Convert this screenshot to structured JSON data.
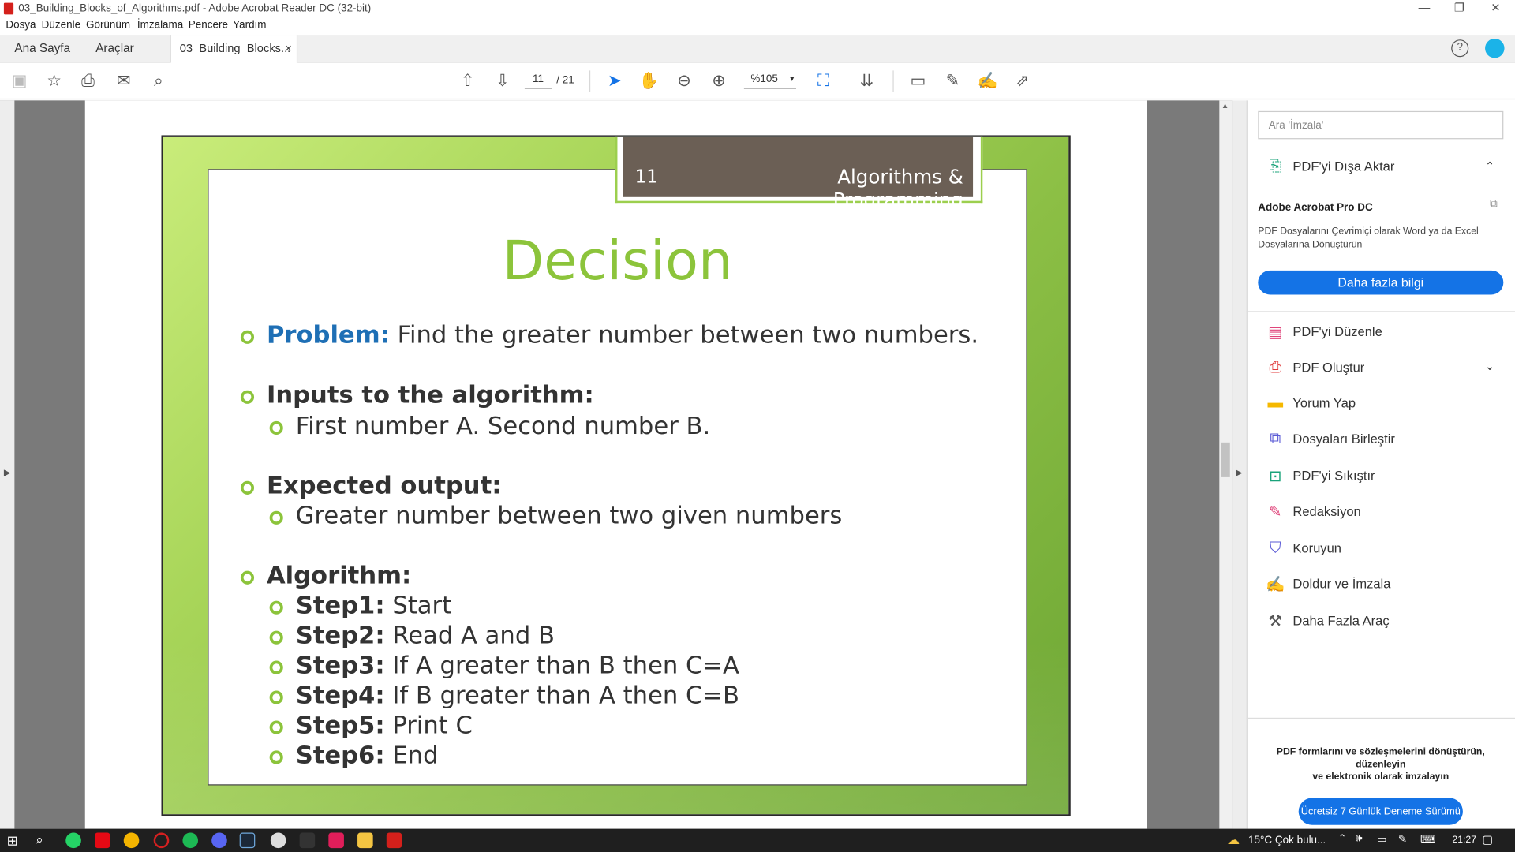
{
  "window": {
    "title": "03_Building_Blocks_of_Algorithms.pdf - Adobe Acrobat Reader DC (32-bit)"
  },
  "menu": [
    "Dosya",
    "Düzenle",
    "Görünüm",
    "İmzalama",
    "Pencere",
    "Yardım"
  ],
  "tabs": {
    "home": "Ana Sayfa",
    "tools": "Araçlar",
    "doc": "03_Building_Blocks...",
    "close": "×"
  },
  "toolbar": {
    "page_current": "11",
    "page_total": "/ 21",
    "zoom": "%105"
  },
  "slide": {
    "number": "11",
    "header": "Algorithms & Programming",
    "title": "Decision",
    "problem_label": "Problem:",
    "problem_text": " Find the greater number between two numbers.",
    "inputs_label": "Inputs to the algorithm:",
    "inputs_text": "First number A. Second number B.",
    "output_label": "Expected output:",
    "output_text": "Greater number between two given numbers",
    "algorithm_label": "Algorithm:",
    "steps": [
      {
        "label": "Step1:",
        "text": " Start"
      },
      {
        "label": "Step2:",
        "text": " Read A and B"
      },
      {
        "label": "Step3:",
        "text": " If A greater than B then C=A"
      },
      {
        "label": "Step4:",
        "text": " If B greater than A then C=B"
      },
      {
        "label": "Step5:",
        "text": " Print C"
      },
      {
        "label": "Step6:",
        "text": " End"
      }
    ]
  },
  "sidepanel": {
    "search_placeholder": "Ara 'İmzala'",
    "export_pdf": "PDF'yi Dışa Aktar",
    "promo_title": "Adobe Acrobat Pro DC",
    "promo_text": "PDF Dosyalarını Çevrimiçi olarak Word ya da Excel Dosyalarına Dönüştürün",
    "promo_button": "Daha fazla bilgi",
    "tools": [
      {
        "label": "PDF'yi Düzenle",
        "icon": "edit-pdf-icon",
        "color": "#e0457b"
      },
      {
        "label": "PDF Oluştur",
        "icon": "create-pdf-icon",
        "color": "#e03b3b"
      },
      {
        "label": "Yorum Yap",
        "icon": "comment-icon",
        "color": "#f5b800"
      },
      {
        "label": "Dosyaları Birleştir",
        "icon": "combine-files-icon",
        "color": "#5a5ad6"
      },
      {
        "label": "PDF'yi Sıkıştır",
        "icon": "compress-pdf-icon",
        "color": "#1aa37a"
      },
      {
        "label": "Redaksiyon",
        "icon": "redact-icon",
        "color": "#e0457b"
      },
      {
        "label": "Koruyun",
        "icon": "protect-icon",
        "color": "#5a5ad6"
      },
      {
        "label": "Doldur ve İmzala",
        "icon": "fill-sign-icon",
        "color": "#8e44ad"
      },
      {
        "label": "Daha Fazla Araç",
        "icon": "more-tools-icon",
        "color": "#555555"
      }
    ],
    "footer_text_1": "PDF formlarını ve sözleşmelerini dönüştürün, düzenleyin",
    "footer_text_2": "ve elektronik olarak imzalayın",
    "trial_button": "Ücretsiz 7 Günlük Deneme Sürümü"
  },
  "taskbar": {
    "weather": "15°C  Çok bulu...",
    "clock": "21:27"
  },
  "colors": {
    "accent": "#1473e6",
    "slide_green": "#8cc43b",
    "header_brown": "#6b5f55",
    "problem_blue": "#1e6fb5"
  }
}
